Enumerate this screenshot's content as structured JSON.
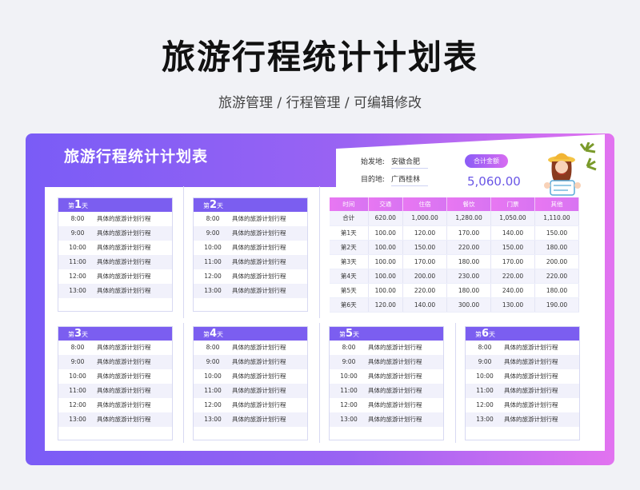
{
  "header": {
    "title": "旅游行程统计计划表",
    "subtitle": "旅游管理 / 行程管理 /  可编辑修改"
  },
  "frame": {
    "title": "旅游行程统计计划表"
  },
  "info": {
    "origin_label": "始发地:",
    "origin_value": "安徽合肥",
    "dest_label": "目的地:",
    "dest_value": "广西桂林",
    "total_label": "合计金额",
    "total_value": "5,060.00"
  },
  "days": [
    {
      "prefix": "第",
      "num": "1",
      "suffix": "天"
    },
    {
      "prefix": "第",
      "num": "2",
      "suffix": "天"
    },
    {
      "prefix": "第",
      "num": "3",
      "suffix": "天"
    },
    {
      "prefix": "第",
      "num": "4",
      "suffix": "天"
    },
    {
      "prefix": "第",
      "num": "5",
      "suffix": "天"
    },
    {
      "prefix": "第",
      "num": "6",
      "suffix": "天"
    }
  ],
  "schedule": {
    "times": [
      "8:00",
      "9:00",
      "10:00",
      "11:00",
      "12:00",
      "13:00"
    ],
    "item": "具体的旅游计划行程"
  },
  "summary": {
    "headers": [
      "时间",
      "交通",
      "住宿",
      "餐饮",
      "门票",
      "其他"
    ],
    "rows": [
      [
        "合计",
        "620.00",
        "1,000.00",
        "1,280.00",
        "1,050.00",
        "1,110.00"
      ],
      [
        "第1天",
        "100.00",
        "120.00",
        "170.00",
        "140.00",
        "150.00"
      ],
      [
        "第2天",
        "100.00",
        "150.00",
        "220.00",
        "150.00",
        "180.00"
      ],
      [
        "第3天",
        "100.00",
        "170.00",
        "180.00",
        "170.00",
        "200.00"
      ],
      [
        "第4天",
        "100.00",
        "200.00",
        "230.00",
        "220.00",
        "220.00"
      ],
      [
        "第5天",
        "100.00",
        "220.00",
        "180.00",
        "240.00",
        "180.00"
      ],
      [
        "第6天",
        "120.00",
        "140.00",
        "300.00",
        "130.00",
        "190.00"
      ]
    ]
  },
  "colors": {
    "accent": "#7b5ef0",
    "pink": "#e877f2"
  }
}
